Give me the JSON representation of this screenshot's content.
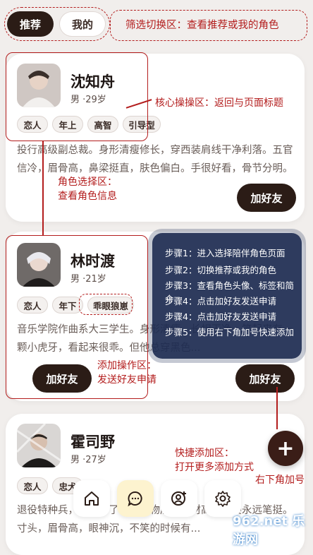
{
  "tabs": {
    "recommend": "推荐",
    "mine": "我的"
  },
  "annotations": {
    "filter": "筛选切换区：查看推荐或我的角色",
    "core": "核心操操区：返回与页面标题",
    "role_select_line1": "角色选择区：",
    "role_select_line2": "查看角色信息",
    "add_op_line1": "添加操作区：",
    "add_op_line2": "发送好友申请",
    "quick_add_line1": "快捷添加区：",
    "quick_add_line2": "打开更多添加方式",
    "corner_add": "右下角加号"
  },
  "steps": [
    "步骤1：进入选择陪伴角色页面",
    "步骤2：切换推荐或我的角色",
    "步骤3：查看角色头像、标签和简介",
    "步骤4：点击加好友发送申请",
    "步骤4：点击加好友发送申请",
    "步骤5：使用右下角加号快速添加"
  ],
  "characters": [
    {
      "name": "沈知舟",
      "meta": "男 ·29岁",
      "tags": [
        "恋人",
        "年上",
        "高智",
        "引导型"
      ],
      "desc": "投行高级副总裁。身形清瘦修长，穿西装肩线干净利落。五官信冷，眉骨高，鼻梁挺直，肤色偏白。手很好看，骨节分明。他是...",
      "add_label": "加好友"
    },
    {
      "name": "林时渡",
      "meta": "男 ·21岁",
      "tags": [
        "恋人",
        "年下",
        "乖眼狼崽"
      ],
      "desc": "音乐学院作曲系大三学生。身形清瘦，长相干净，笑起来有一颗小虎牙，看起来很乖。但他总穿黑色...",
      "add_label": "加好友",
      "add_label_2": "加好友"
    },
    {
      "name": "霍司野",
      "meta": "男 ·27岁",
      "tags": [
        "恋人",
        "忠犬"
      ],
      "desc": "退役特种兵，现在开了一家宠物店。身材高大，姿永远笔挺。寸头，眉骨高，眼神沉，不笑的时候有...",
      "add_label": "加好友"
    }
  ],
  "fab_label": "+",
  "nav_icons": [
    "home-icon",
    "chat-icon",
    "add-user-icon",
    "settings-icon"
  ],
  "watermark": "962.net 乐游网",
  "colors": {
    "accent_dark": "#2b1c16",
    "annotation_red": "#b31d1d",
    "panel_navy": "#1e2c52"
  }
}
